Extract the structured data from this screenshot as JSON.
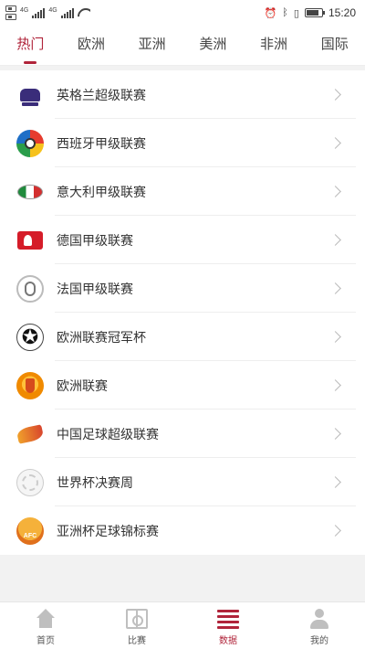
{
  "status_bar": {
    "net_label_1": "4G",
    "net_label_2": "4G",
    "time": "15:20",
    "battery_level": 0.8
  },
  "tabs": [
    {
      "label": "热门",
      "active": true
    },
    {
      "label": "欧洲",
      "active": false
    },
    {
      "label": "亚洲",
      "active": false
    },
    {
      "label": "美洲",
      "active": false
    },
    {
      "label": "非洲",
      "active": false
    },
    {
      "label": "国际",
      "active": false
    }
  ],
  "leagues": [
    {
      "label": "英格兰超级联赛",
      "icon": "premier-league-logo-icon"
    },
    {
      "label": "西班牙甲级联赛",
      "icon": "la-liga-logo-icon"
    },
    {
      "label": "意大利甲级联赛",
      "icon": "serie-a-logo-icon"
    },
    {
      "label": "德国甲级联赛",
      "icon": "bundesliga-logo-icon"
    },
    {
      "label": "法国甲级联赛",
      "icon": "ligue-1-logo-icon"
    },
    {
      "label": "欧洲联赛冠军杯",
      "icon": "champions-league-logo-icon"
    },
    {
      "label": "欧洲联赛",
      "icon": "europa-league-logo-icon"
    },
    {
      "label": "中国足球超级联赛",
      "icon": "csl-logo-icon"
    },
    {
      "label": "世界杯决赛周",
      "icon": "world-cup-logo-icon"
    },
    {
      "label": "亚洲杯足球锦标赛",
      "icon": "asian-cup-logo-icon"
    }
  ],
  "logo_text": {
    "afc": "AFC"
  },
  "bottom_nav": [
    {
      "label": "首页",
      "icon": "home-icon",
      "active": false
    },
    {
      "label": "比赛",
      "icon": "match-icon",
      "active": false
    },
    {
      "label": "数据",
      "icon": "data-icon",
      "active": true
    },
    {
      "label": "我的",
      "icon": "profile-icon",
      "active": false
    }
  ],
  "colors": {
    "accent": "#b0243a",
    "inactive_icon": "#bfbfbf"
  }
}
